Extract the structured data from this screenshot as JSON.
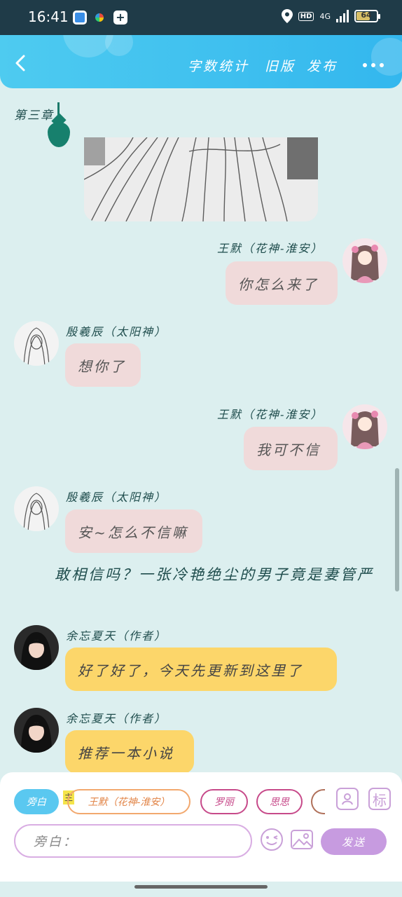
{
  "status_bar": {
    "time": "16:41",
    "network_hd": "HD",
    "network_type": "4G",
    "battery_level": "64"
  },
  "header": {
    "word_count_label": "字数统计",
    "old_version_label": "旧版",
    "publish_label": "发布"
  },
  "chapter_title": "第三章",
  "messages": [
    {
      "speaker": "王默（花神-淮安）",
      "text": "你怎么来了",
      "side": "right",
      "color": "pink"
    },
    {
      "speaker": "殷羲辰（太阳神）",
      "text": "想你了",
      "side": "left",
      "color": "pink"
    },
    {
      "speaker": "王默（花神-淮安）",
      "text": "我可不信",
      "side": "right",
      "color": "pink"
    },
    {
      "speaker": "殷羲辰（太阳神）",
      "text": "安~怎么不信嘛",
      "side": "left",
      "color": "pink"
    },
    {
      "speaker": "余忘夏天（作者）",
      "text": "好了好了，今天先更新到这里了",
      "side": "left",
      "color": "yellow"
    },
    {
      "speaker": "余忘夏天（作者）",
      "text": "推荐一本小说",
      "side": "left",
      "color": "yellow"
    }
  ],
  "narration": "敢相信吗？一张冷艳绝尘的男子竟是妻管严",
  "composer": {
    "role_chips": [
      "旁白",
      "王默（花神-淮安）",
      "罗丽",
      "思思"
    ],
    "main_tag": "主",
    "role_icon": "person-card-icon",
    "tag_icon_label": "标",
    "input_placeholder": "旁白：",
    "send_label": "发送"
  },
  "colors": {
    "header": "#33b7ee",
    "background": "#dcefef",
    "pink_bubble": "#f0dada",
    "yellow_bubble": "#fcd66a",
    "send_button": "#c79be0"
  }
}
